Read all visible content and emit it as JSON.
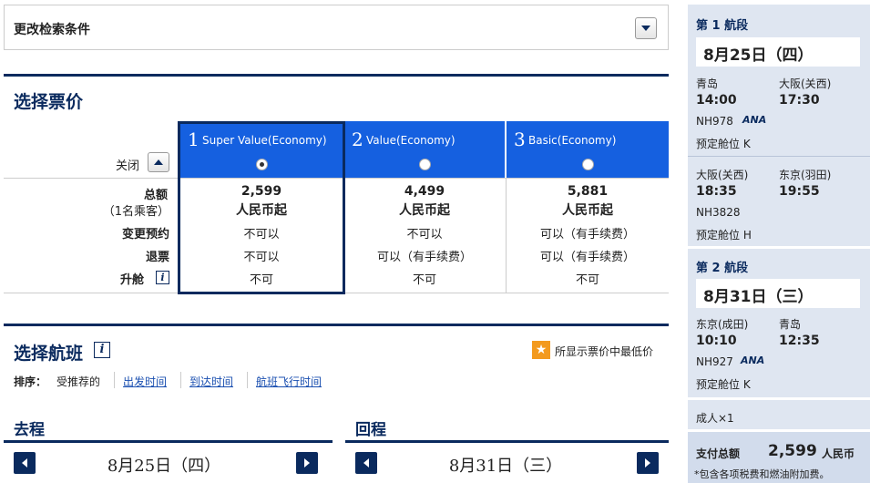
{
  "search": {
    "label": "更改检索条件"
  },
  "fare": {
    "title": "选择票价",
    "close_label": "关闭",
    "row_labels": {
      "total": "总额",
      "per": "（1名乘客）",
      "change": "变更预约",
      "refund": "退票",
      "upgrade": "升舱"
    },
    "columns": [
      {
        "num": "1",
        "name": "Super Value(Economy)",
        "price": "2,599",
        "unit": "人民币起",
        "change": "不可以",
        "refund": "不可以",
        "upgrade": "不可"
      },
      {
        "num": "2",
        "name": "Value(Economy)",
        "price": "4,499",
        "unit": "人民币起",
        "change": "不可以",
        "refund": "可以（有手续费）",
        "upgrade": "不可"
      },
      {
        "num": "3",
        "name": "Basic(Economy)",
        "price": "5,881",
        "unit": "人民币起",
        "change": "可以（有手续费）",
        "refund": "可以（有手续费）",
        "upgrade": "不可"
      }
    ]
  },
  "flights": {
    "title": "选择航班",
    "lowest_note": "所显示票价中最低价",
    "sort_label": "排序：",
    "sort_options": [
      "受推荐的",
      "出发时间",
      "到达时间",
      "航班飞行时间"
    ],
    "outbound": {
      "label": "去程",
      "date": "8月25日（四）"
    },
    "return": {
      "label": "回程",
      "date": "8月31日（三）"
    }
  },
  "itinerary": {
    "seg1": {
      "title": "第 1 航段",
      "date": "8月25日（四）",
      "leg1": {
        "from": "青岛",
        "to": "大阪(关西)",
        "dep": "14:00",
        "arr": "17:30",
        "flight": "NH978",
        "class": "预定舱位 K"
      },
      "leg2": {
        "from": "大阪(关西)",
        "to": "东京(羽田)",
        "dep": "18:35",
        "arr": "19:55",
        "flight": "NH3828",
        "class": "预定舱位 H"
      }
    },
    "seg2": {
      "title": "第 2 航段",
      "date": "8月31日（三）",
      "leg1": {
        "from": "东京(成田)",
        "to": "青岛",
        "dep": "10:10",
        "arr": "12:35",
        "flight": "NH927",
        "class": "预定舱位 K"
      }
    },
    "pax": "成人×1",
    "total_label": "支付总额",
    "total_value": "2,599",
    "total_unit": "人民币",
    "note": "*包含各项税费和燃油附加费。",
    "airline_logo": "ANA"
  },
  "colors": {
    "navy": "#0a2a5e",
    "blue": "#1560e0",
    "side_bg": "#dfe6f1",
    "star": "#f39a1e"
  }
}
